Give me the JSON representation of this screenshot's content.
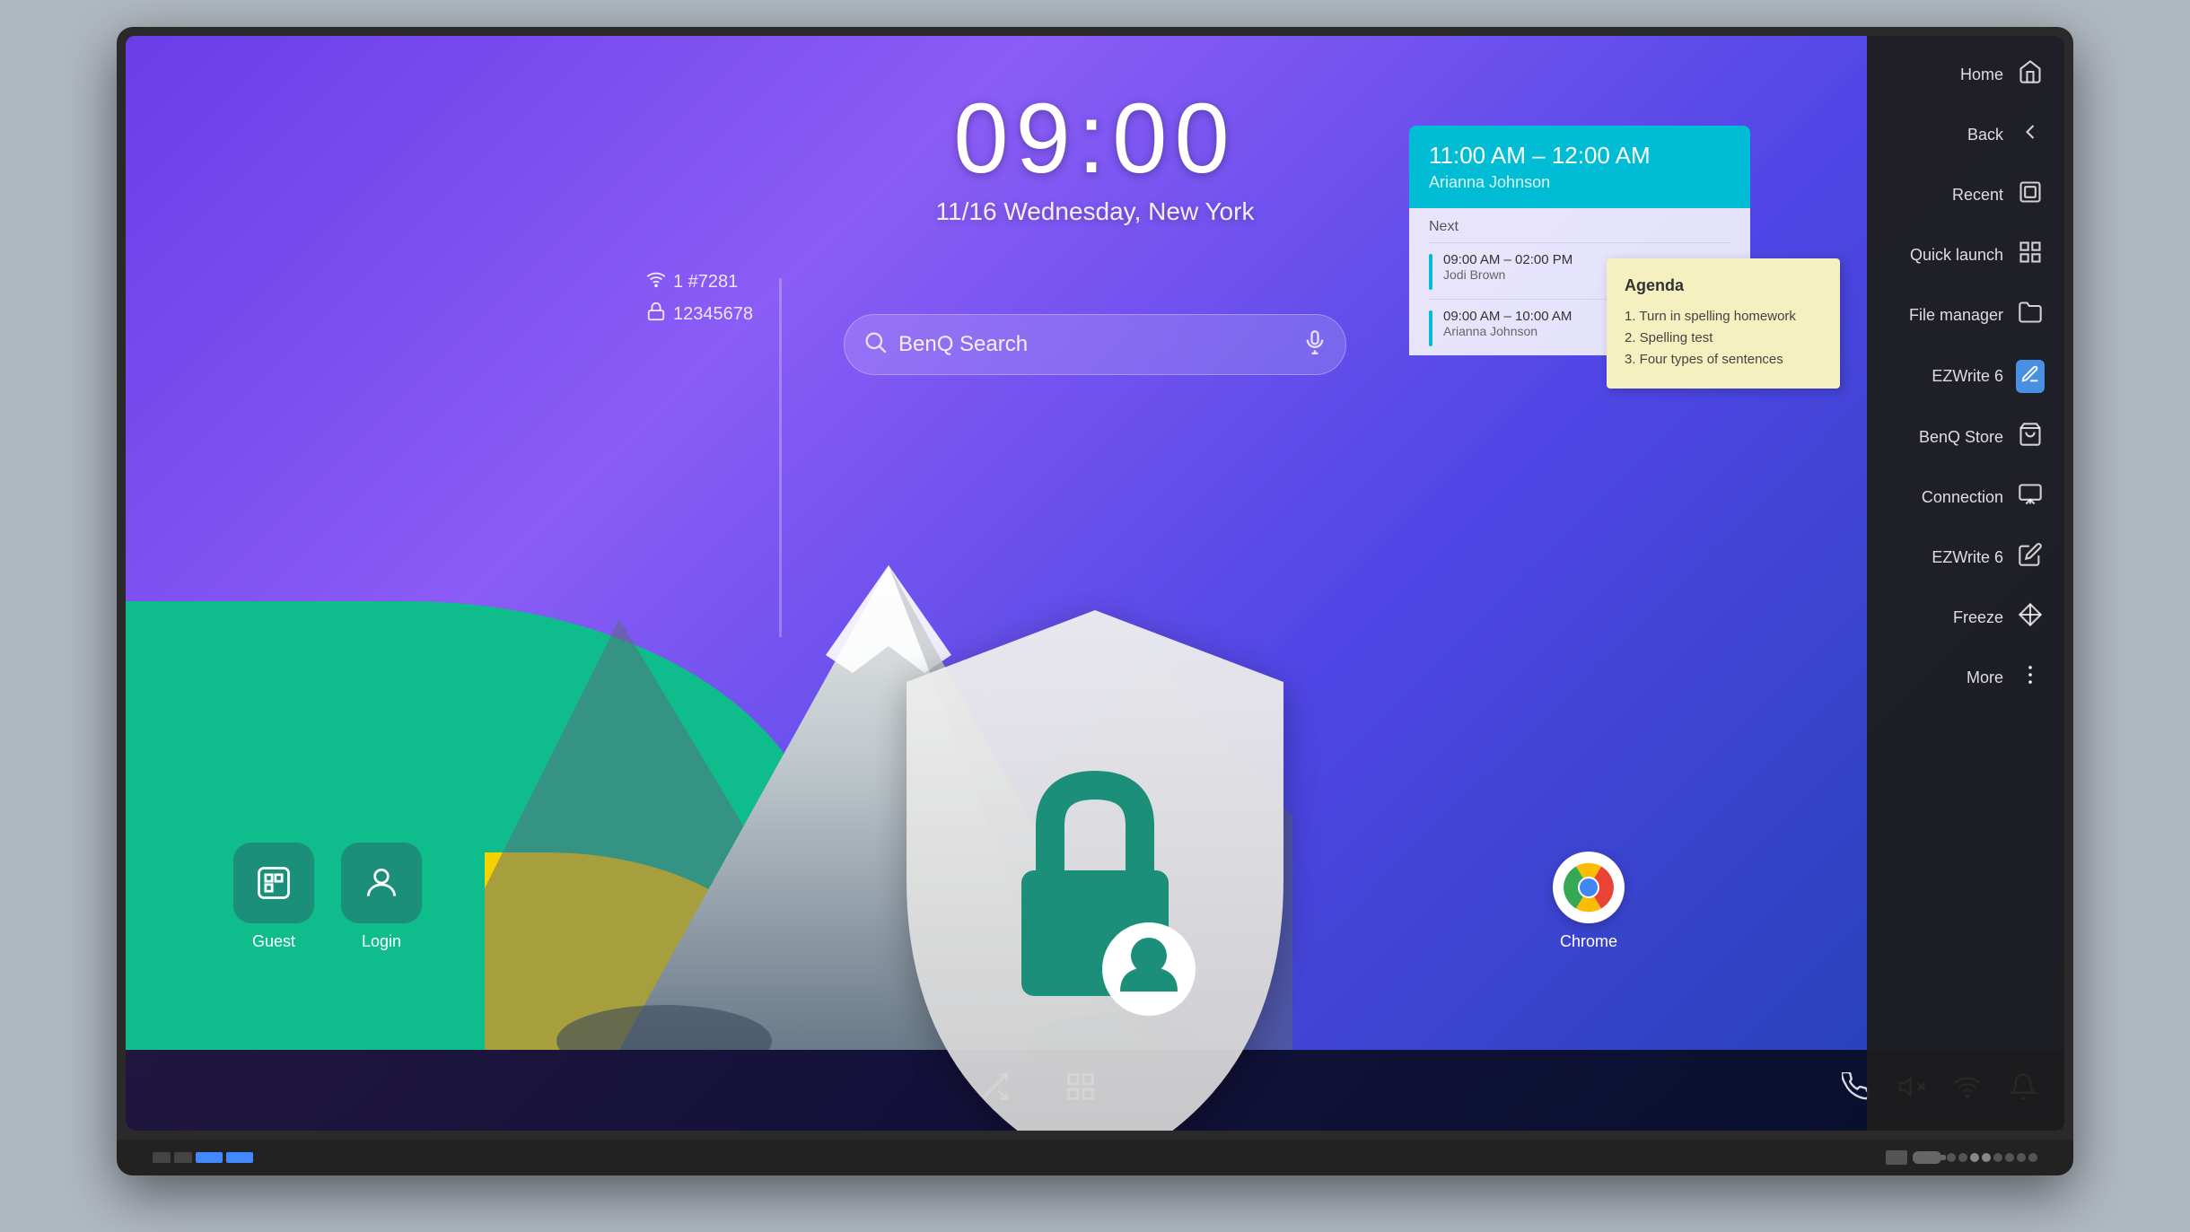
{
  "monitor": {
    "screen_bg": "#4a2fa0"
  },
  "time": {
    "clock": "09:00",
    "date": "11/16 Wednesday, New York"
  },
  "search": {
    "placeholder": "BenQ Search"
  },
  "calendar": {
    "current_time": "11:00 AM – 12:00 AM",
    "current_person": "Arianna Johnson",
    "next_label": "Next",
    "items": [
      {
        "time": "09:00 AM – 02:00 PM",
        "person": "Jodi Brown"
      },
      {
        "time": "09:00 AM – 10:00 AM",
        "person": "Arianna Johnson"
      }
    ]
  },
  "room": {
    "wifi_number": "1 #7281",
    "password": "12345678"
  },
  "agenda": {
    "title": "Agenda",
    "items": [
      "1. Turn in spelling homework",
      "2. Spelling test",
      "3. Four types of sentences"
    ]
  },
  "user_buttons": [
    {
      "id": "guest",
      "label": "Guest",
      "icon": "⊡"
    },
    {
      "id": "login",
      "label": "Login",
      "icon": "👤"
    }
  ],
  "chrome_app": {
    "label": "Chrome"
  },
  "sidebar": {
    "items": [
      {
        "id": "home",
        "label": "Home",
        "icon": "⌂"
      },
      {
        "id": "back",
        "label": "Back",
        "icon": "↩"
      },
      {
        "id": "recent",
        "label": "Recent",
        "icon": "▣"
      },
      {
        "id": "quick-launch",
        "label": "Quick launch",
        "icon": "⊞"
      },
      {
        "id": "file-manager",
        "label": "File manager",
        "icon": "📁"
      },
      {
        "id": "ezwrite6-1",
        "label": "EZWrite 6",
        "icon": "✏"
      },
      {
        "id": "benq-store",
        "label": "BenQ Store",
        "icon": "🏪"
      },
      {
        "id": "connection",
        "label": "Connection",
        "icon": "⤓"
      },
      {
        "id": "ezwrite6-2",
        "label": "EZWrite 6",
        "icon": "✏"
      },
      {
        "id": "freeze",
        "label": "Freeze",
        "icon": "❄"
      },
      {
        "id": "more",
        "label": "More",
        "icon": "⋮"
      }
    ]
  },
  "taskbar": {
    "icons": [
      {
        "id": "cast",
        "symbol": "⬆"
      },
      {
        "id": "grid",
        "symbol": "⊞"
      },
      {
        "id": "phone",
        "symbol": "☎"
      },
      {
        "id": "mute",
        "symbol": "🔇"
      },
      {
        "id": "wifi",
        "symbol": "📶"
      },
      {
        "id": "bell",
        "symbol": "🔔"
      }
    ]
  },
  "colors": {
    "teal": "#0fbc8c",
    "yellow": "#f5d300",
    "cyan": "#00bcd4",
    "sidebar_bg": "rgba(30,30,30,0.95)",
    "shield_teal": "#1b8f7a"
  }
}
